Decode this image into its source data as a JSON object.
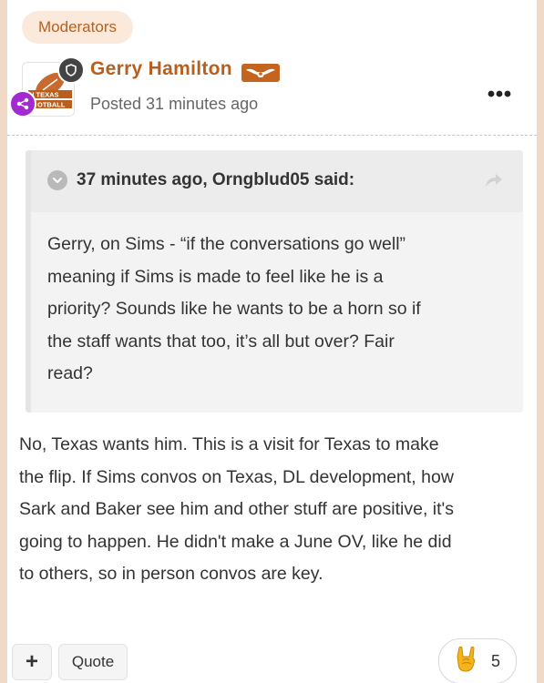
{
  "badge": {
    "label": "Moderators"
  },
  "author": {
    "name": "Gerry Hamilton",
    "posted": "Posted 31 minutes ago",
    "avatar_text": [
      "N TEXAS",
      "OTBALL"
    ]
  },
  "quote": {
    "citation": "37 minutes ago, Orngblud05 said:",
    "lines": [
      "Gerry, on Sims - “if the conversations go well”",
      "meaning if Sims is made to feel like he is a",
      "priority?  Sounds like he wants to be a horn so if",
      "the staff wants that too, it’s all but over?  Fair",
      "read?"
    ]
  },
  "post": {
    "lines": [
      "No, Texas wants him. This is a visit for Texas to make",
      "the flip. If Sims convos on Texas, DL development, how",
      "Sark and Baker see him and other stuff are positive, it's",
      "going to happen. He didn't make a June OV, like he did",
      "to others, so in person convos are key."
    ]
  },
  "actions": {
    "plus_label": "+",
    "quote_label": "Quote",
    "reaction_count": "5"
  },
  "icons": {
    "shield": "shield-icon",
    "share": "share-icon",
    "rank": "longhorn-rank-icon",
    "more": "more-options-icon",
    "toggle": "chevron-down-icon",
    "quote_share": "share-arrow-icon",
    "reaction": "hook-em-hand-icon"
  },
  "colors": {
    "accent": "#b95f1d",
    "page_background": "#f0d9c6",
    "share_badge": "#a12bd1"
  }
}
